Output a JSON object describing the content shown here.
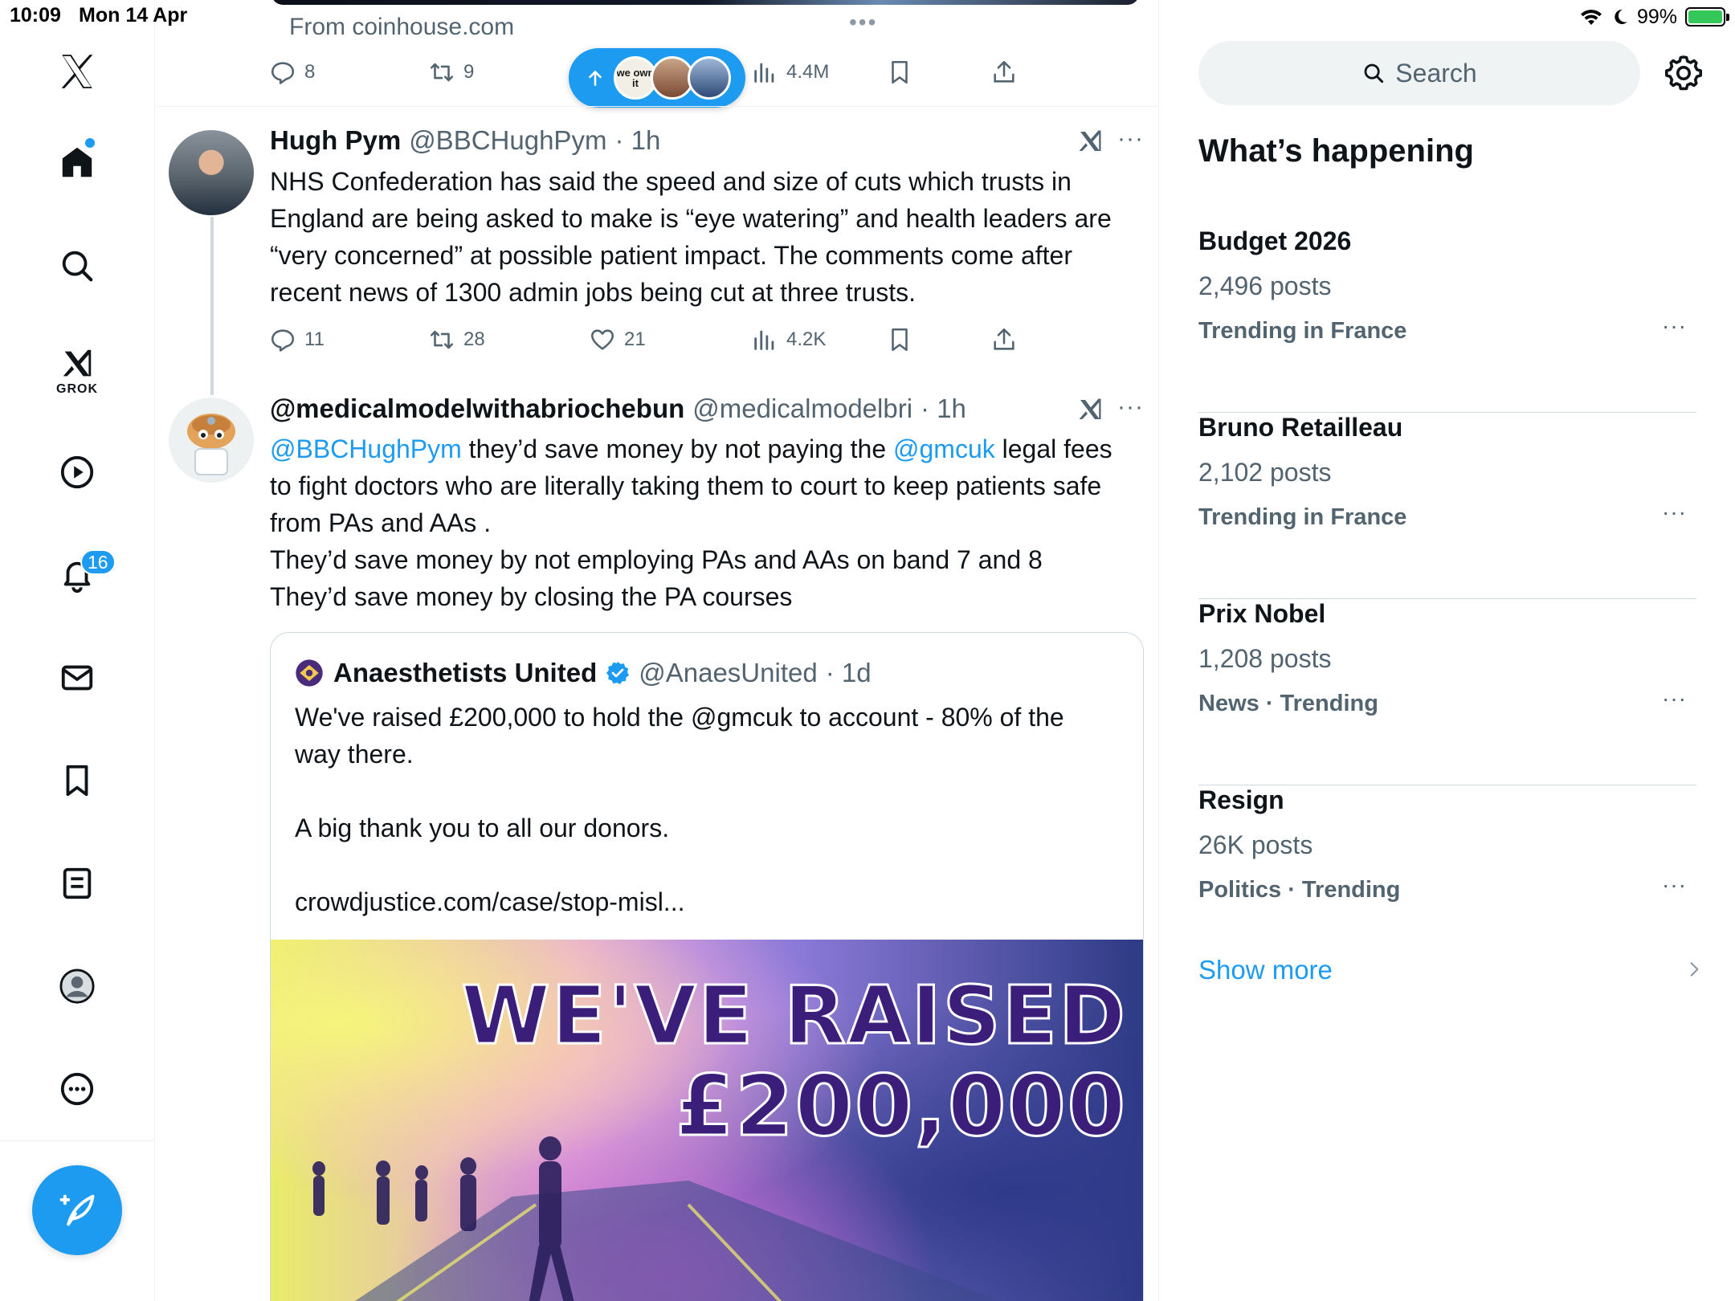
{
  "status": {
    "time": "10:09",
    "date": "Mon 14 Apr",
    "battery": "99%"
  },
  "nav": {
    "notifications_badge": "16",
    "grok_label": "GROK"
  },
  "colors": {
    "accent": "#1d9bf0",
    "text": "#0f1419",
    "secondary": "#536471"
  },
  "timeline": {
    "top_post": {
      "source": "From coinhouse.com",
      "replies": "8",
      "reposts": "9",
      "views": "4.4M"
    },
    "new_posts_pill": {
      "avatar_text": "we own it"
    },
    "tweet1": {
      "name": "Hugh Pym",
      "handle": "@BBCHughPym",
      "time": "· 1h",
      "text": "NHS Confederation has said the speed and size of cuts which trusts in England are being asked to make is “eye watering” and health leaders are “very concerned” at possible patient impact. The comments come after recent news of 1300 admin jobs being cut at three trusts.",
      "replies": "11",
      "reposts": "28",
      "likes": "21",
      "views": "4.2K"
    },
    "tweet2": {
      "name": "@medicalmodelwithabriochebun",
      "handle": "@medicalmodelbri",
      "time": "· 1h",
      "mention1": "@BBCHughPym",
      "text_a": " they’d save money by not paying the ",
      "mention2": "@gmcuk",
      "text_b": " legal fees to fight doctors who are literally taking them to court to keep patients safe from PAs and AAs .",
      "line2": "They’d save money by not employing PAs and AAs on band 7 and 8",
      "line3": "They’d save money by closing the PA courses",
      "quote": {
        "name": "Anaesthetists United",
        "handle": "@AnaesUnited",
        "time": "· 1d",
        "line1": "We've raised £200,000 to hold the @gmcuk  to account -  80% of the way there.",
        "line2": "A big thank you to all our donors.",
        "line3": "crowdjustice.com/case/stop-misl...",
        "image_line1": "WE'VE RAISED",
        "image_line2": "£200,000"
      }
    }
  },
  "sidebar": {
    "search_placeholder": "Search",
    "title": "What’s happening",
    "trends": [
      {
        "name": "Budget 2026",
        "count": "2,496 posts",
        "meta": "Trending in France"
      },
      {
        "name": "Bruno Retailleau",
        "count": "2,102 posts",
        "meta": "Trending in France"
      },
      {
        "name": "Prix Nobel",
        "count": "1,208 posts",
        "meta": "News · Trending"
      },
      {
        "name": "Resign",
        "count": "26K posts",
        "meta": "Politics · Trending"
      }
    ],
    "show_more": "Show more"
  }
}
